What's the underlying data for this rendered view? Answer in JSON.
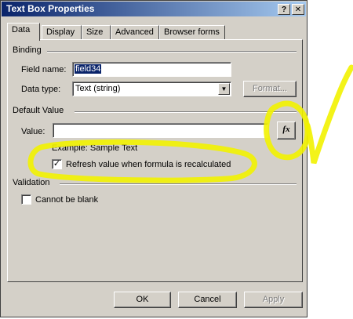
{
  "window": {
    "title": "Text Box Properties",
    "help_button": "?",
    "close_button": "✕"
  },
  "tabs": [
    {
      "label": "Data",
      "active": true
    },
    {
      "label": "Display",
      "active": false
    },
    {
      "label": "Size",
      "active": false
    },
    {
      "label": "Advanced",
      "active": false
    },
    {
      "label": "Browser forms",
      "active": false
    }
  ],
  "binding": {
    "section_title": "Binding",
    "field_name_label": "Field name:",
    "field_name_value": "field34",
    "data_type_label": "Data type:",
    "data_type_value": "Text (string)",
    "format_button": "Format..."
  },
  "default_value": {
    "section_title": "Default Value",
    "value_label": "Value:",
    "value_text": "",
    "formula_button": "fx",
    "example_text": "Example: Sample Text",
    "refresh_checkbox_label": "Refresh value when formula is recalculated",
    "refresh_checked": true
  },
  "validation": {
    "section_title": "Validation",
    "cannot_be_blank_label": "Cannot be blank",
    "cannot_be_blank_checked": false
  },
  "footer": {
    "ok": "OK",
    "cancel": "Cancel",
    "apply": "Apply"
  },
  "colors": {
    "highlighter": "#f2f200",
    "title_bar": "#0a246a",
    "dialog_face": "#d4d0c8"
  }
}
